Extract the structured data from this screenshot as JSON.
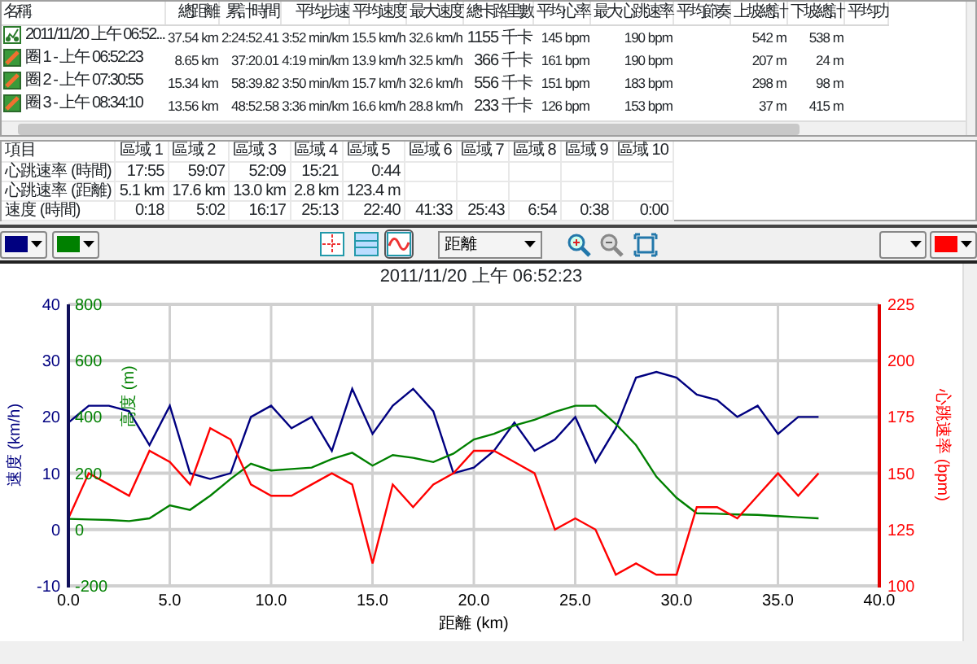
{
  "laps_table": {
    "columns": [
      "名稱",
      "總距離",
      "累計時間",
      "平均步速",
      "平均速度",
      "最大速度",
      "總卡路里數",
      "平均心率",
      "最大心跳速率",
      "平均節奏",
      "上坡總計",
      "下坡總計",
      "平均功"
    ],
    "rows": [
      {
        "kind": "activity",
        "cells": [
          "2011/11/20 上午 06:52...",
          "37.54 km",
          "2:24:52.41",
          "3:52 min/km",
          "15.5 km/h",
          "32.6 km/h",
          "1155 千卡",
          "145 bpm",
          "190 bpm",
          "",
          "542 m",
          "538 m",
          ""
        ]
      },
      {
        "kind": "lap",
        "cells": [
          "圈 1 - 上午 06:52:23",
          "8.65 km",
          "37:20.01",
          "4:19 min/km",
          "13.9 km/h",
          "32.5 km/h",
          "366 千卡",
          "161 bpm",
          "190 bpm",
          "",
          "207 m",
          "24 m",
          ""
        ]
      },
      {
        "kind": "lap",
        "cells": [
          "圈 2 - 上午 07:30:55",
          "15.34 km",
          "58:39.82",
          "3:50 min/km",
          "15.7 km/h",
          "32.6 km/h",
          "556 千卡",
          "151 bpm",
          "183 bpm",
          "",
          "298 m",
          "98 m",
          ""
        ]
      },
      {
        "kind": "lap",
        "cells": [
          "圈 3 - 上午 08:34:10",
          "13.56 km",
          "48:52.58",
          "3:36 min/km",
          "16.6 km/h",
          "28.8 km/h",
          "233 千卡",
          "126 bpm",
          "153 bpm",
          "",
          "37 m",
          "415 m",
          ""
        ]
      }
    ]
  },
  "zones_table": {
    "columns": [
      "項目",
      "區域 1",
      "區域 2",
      "區域 3",
      "區域 4",
      "區域 5",
      "區域 6",
      "區域 7",
      "區域 8",
      "區域 9",
      "區域 10"
    ],
    "rows": [
      [
        "心跳速率 (時間)",
        "17:55",
        "59:07",
        "52:09",
        "15:21",
        "0:44",
        "",
        "",
        "",
        "",
        ""
      ],
      [
        "心跳速率 (距離)",
        "5.1 km",
        "17.6 km",
        "13.0 km",
        "2.8 km",
        "123.4 m",
        "",
        "",
        "",
        "",
        ""
      ],
      [
        "速度 (時間)",
        "0:18",
        "5:02",
        "16:17",
        "25:13",
        "22:40",
        "41:33",
        "25:43",
        "6:54",
        "0:38",
        "0:00"
      ]
    ]
  },
  "toolbar": {
    "left_swatches": [
      {
        "kind": "swatch",
        "color": "#000080"
      },
      {
        "kind": "swatch",
        "color": "#008000"
      }
    ],
    "view_buttons": [
      {
        "kind": "crosshair",
        "selected": false
      },
      {
        "kind": "split",
        "selected": false
      },
      {
        "kind": "wave",
        "selected": true
      }
    ],
    "axis_select": {
      "value": "距離"
    },
    "right_swatches": [
      {
        "kind": "blank"
      },
      {
        "kind": "swatch",
        "color": "#ff0000"
      }
    ]
  },
  "chart": {
    "title": "2011/11/20 上午 06:52:23",
    "chart_data": {
      "type": "line",
      "xlabel": "距離 (km)",
      "xlim": [
        0,
        40
      ],
      "xticks": [
        {
          "value": 0,
          "label": "0.0"
        },
        {
          "value": 5,
          "label": "5.0"
        },
        {
          "value": 10,
          "label": "10.0"
        },
        {
          "value": 15,
          "label": "15.0"
        },
        {
          "value": 20,
          "label": "20.0"
        },
        {
          "value": 25,
          "label": "25.0"
        },
        {
          "value": 30,
          "label": "30.0"
        },
        {
          "value": 35,
          "label": "35.0"
        },
        {
          "value": 40,
          "label": "40.0"
        }
      ],
      "grid": true,
      "ylabel": "速度 (km/h)",
      "ylim": [
        -10,
        40
      ],
      "yticks": [
        -10,
        0,
        10,
        20,
        30,
        40
      ],
      "y2label": "高度 (m)",
      "y2lim": [
        -200,
        800
      ],
      "y2ticks": [
        -200,
        0,
        200,
        400,
        600,
        800
      ],
      "y3label": "心跳速率 (bpm)",
      "y3lim": [
        100,
        225
      ],
      "y3ticks": [
        100,
        125,
        150,
        175,
        200,
        225
      ],
      "x": [
        0,
        1,
        2,
        3,
        4,
        5,
        6,
        7,
        8,
        9,
        10,
        11,
        12,
        13,
        14,
        15,
        16,
        17,
        18,
        19,
        20,
        21,
        22,
        23,
        24,
        25,
        26,
        27,
        28,
        29,
        30,
        31,
        32,
        33,
        34,
        35,
        36,
        37
      ],
      "series": [
        {
          "color": "#000080",
          "values": [
            19,
            22,
            22,
            21,
            15,
            22,
            10,
            9,
            10,
            20,
            22,
            18,
            20,
            14,
            25,
            17,
            22,
            25,
            21,
            10,
            11,
            14,
            19,
            14,
            16,
            20,
            12,
            18,
            27,
            28,
            27,
            24,
            23,
            20,
            22,
            17,
            20,
            20
          ]
        },
        {
          "color": "#008000",
          "axis": "y2",
          "values": [
            38,
            36,
            34,
            30,
            40,
            86,
            70,
            120,
            180,
            234,
            210,
            215,
            220,
            250,
            273,
            227,
            265,
            255,
            240,
            270,
            320,
            340,
            370,
            390,
            418,
            440,
            440,
            375,
            300,
            188,
            113,
            58,
            56,
            54,
            52,
            48,
            44,
            40
          ]
        },
        {
          "color": "#ff0000",
          "axis": "y3",
          "values": [
            130,
            150,
            145,
            140,
            160,
            155,
            145,
            170,
            165,
            145,
            140,
            140,
            145,
            150,
            145,
            110,
            145,
            135,
            145,
            150,
            160,
            160,
            155,
            150,
            125,
            130,
            125,
            105,
            110,
            105,
            105,
            135,
            135,
            130,
            140,
            150,
            140,
            150
          ]
        }
      ]
    }
  }
}
